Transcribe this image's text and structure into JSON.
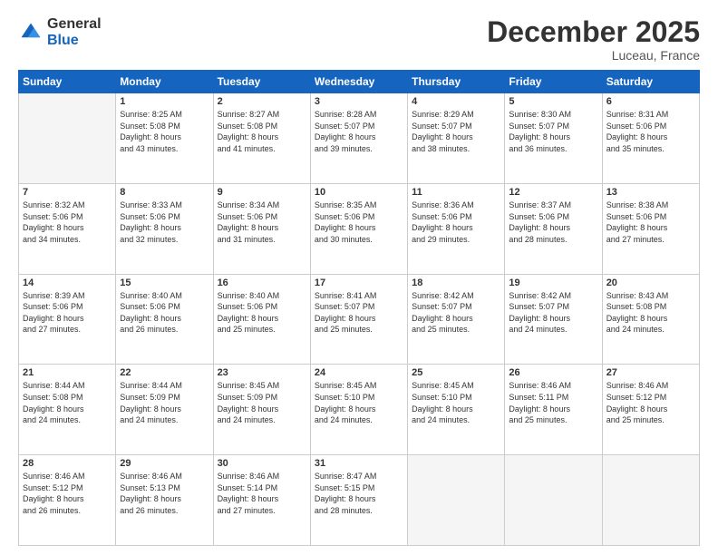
{
  "logo": {
    "general": "General",
    "blue": "Blue"
  },
  "header": {
    "month": "December 2025",
    "location": "Luceau, France"
  },
  "weekdays": [
    "Sunday",
    "Monday",
    "Tuesday",
    "Wednesday",
    "Thursday",
    "Friday",
    "Saturday"
  ],
  "weeks": [
    [
      {
        "day": "",
        "empty": true
      },
      {
        "day": "1",
        "sunrise": "Sunrise: 8:25 AM",
        "sunset": "Sunset: 5:08 PM",
        "daylight": "Daylight: 8 hours and 43 minutes."
      },
      {
        "day": "2",
        "sunrise": "Sunrise: 8:27 AM",
        "sunset": "Sunset: 5:08 PM",
        "daylight": "Daylight: 8 hours and 41 minutes."
      },
      {
        "day": "3",
        "sunrise": "Sunrise: 8:28 AM",
        "sunset": "Sunset: 5:07 PM",
        "daylight": "Daylight: 8 hours and 39 minutes."
      },
      {
        "day": "4",
        "sunrise": "Sunrise: 8:29 AM",
        "sunset": "Sunset: 5:07 PM",
        "daylight": "Daylight: 8 hours and 38 minutes."
      },
      {
        "day": "5",
        "sunrise": "Sunrise: 8:30 AM",
        "sunset": "Sunset: 5:07 PM",
        "daylight": "Daylight: 8 hours and 36 minutes."
      },
      {
        "day": "6",
        "sunrise": "Sunrise: 8:31 AM",
        "sunset": "Sunset: 5:06 PM",
        "daylight": "Daylight: 8 hours and 35 minutes."
      }
    ],
    [
      {
        "day": "7",
        "sunrise": "Sunrise: 8:32 AM",
        "sunset": "Sunset: 5:06 PM",
        "daylight": "Daylight: 8 hours and 34 minutes."
      },
      {
        "day": "8",
        "sunrise": "Sunrise: 8:33 AM",
        "sunset": "Sunset: 5:06 PM",
        "daylight": "Daylight: 8 hours and 32 minutes."
      },
      {
        "day": "9",
        "sunrise": "Sunrise: 8:34 AM",
        "sunset": "Sunset: 5:06 PM",
        "daylight": "Daylight: 8 hours and 31 minutes."
      },
      {
        "day": "10",
        "sunrise": "Sunrise: 8:35 AM",
        "sunset": "Sunset: 5:06 PM",
        "daylight": "Daylight: 8 hours and 30 minutes."
      },
      {
        "day": "11",
        "sunrise": "Sunrise: 8:36 AM",
        "sunset": "Sunset: 5:06 PM",
        "daylight": "Daylight: 8 hours and 29 minutes."
      },
      {
        "day": "12",
        "sunrise": "Sunrise: 8:37 AM",
        "sunset": "Sunset: 5:06 PM",
        "daylight": "Daylight: 8 hours and 28 minutes."
      },
      {
        "day": "13",
        "sunrise": "Sunrise: 8:38 AM",
        "sunset": "Sunset: 5:06 PM",
        "daylight": "Daylight: 8 hours and 27 minutes."
      }
    ],
    [
      {
        "day": "14",
        "sunrise": "Sunrise: 8:39 AM",
        "sunset": "Sunset: 5:06 PM",
        "daylight": "Daylight: 8 hours and 27 minutes."
      },
      {
        "day": "15",
        "sunrise": "Sunrise: 8:40 AM",
        "sunset": "Sunset: 5:06 PM",
        "daylight": "Daylight: 8 hours and 26 minutes."
      },
      {
        "day": "16",
        "sunrise": "Sunrise: 8:40 AM",
        "sunset": "Sunset: 5:06 PM",
        "daylight": "Daylight: 8 hours and 25 minutes."
      },
      {
        "day": "17",
        "sunrise": "Sunrise: 8:41 AM",
        "sunset": "Sunset: 5:07 PM",
        "daylight": "Daylight: 8 hours and 25 minutes."
      },
      {
        "day": "18",
        "sunrise": "Sunrise: 8:42 AM",
        "sunset": "Sunset: 5:07 PM",
        "daylight": "Daylight: 8 hours and 25 minutes."
      },
      {
        "day": "19",
        "sunrise": "Sunrise: 8:42 AM",
        "sunset": "Sunset: 5:07 PM",
        "daylight": "Daylight: 8 hours and 24 minutes."
      },
      {
        "day": "20",
        "sunrise": "Sunrise: 8:43 AM",
        "sunset": "Sunset: 5:08 PM",
        "daylight": "Daylight: 8 hours and 24 minutes."
      }
    ],
    [
      {
        "day": "21",
        "sunrise": "Sunrise: 8:44 AM",
        "sunset": "Sunset: 5:08 PM",
        "daylight": "Daylight: 8 hours and 24 minutes."
      },
      {
        "day": "22",
        "sunrise": "Sunrise: 8:44 AM",
        "sunset": "Sunset: 5:09 PM",
        "daylight": "Daylight: 8 hours and 24 minutes."
      },
      {
        "day": "23",
        "sunrise": "Sunrise: 8:45 AM",
        "sunset": "Sunset: 5:09 PM",
        "daylight": "Daylight: 8 hours and 24 minutes."
      },
      {
        "day": "24",
        "sunrise": "Sunrise: 8:45 AM",
        "sunset": "Sunset: 5:10 PM",
        "daylight": "Daylight: 8 hours and 24 minutes."
      },
      {
        "day": "25",
        "sunrise": "Sunrise: 8:45 AM",
        "sunset": "Sunset: 5:10 PM",
        "daylight": "Daylight: 8 hours and 24 minutes."
      },
      {
        "day": "26",
        "sunrise": "Sunrise: 8:46 AM",
        "sunset": "Sunset: 5:11 PM",
        "daylight": "Daylight: 8 hours and 25 minutes."
      },
      {
        "day": "27",
        "sunrise": "Sunrise: 8:46 AM",
        "sunset": "Sunset: 5:12 PM",
        "daylight": "Daylight: 8 hours and 25 minutes."
      }
    ],
    [
      {
        "day": "28",
        "sunrise": "Sunrise: 8:46 AM",
        "sunset": "Sunset: 5:12 PM",
        "daylight": "Daylight: 8 hours and 26 minutes."
      },
      {
        "day": "29",
        "sunrise": "Sunrise: 8:46 AM",
        "sunset": "Sunset: 5:13 PM",
        "daylight": "Daylight: 8 hours and 26 minutes."
      },
      {
        "day": "30",
        "sunrise": "Sunrise: 8:46 AM",
        "sunset": "Sunset: 5:14 PM",
        "daylight": "Daylight: 8 hours and 27 minutes."
      },
      {
        "day": "31",
        "sunrise": "Sunrise: 8:47 AM",
        "sunset": "Sunset: 5:15 PM",
        "daylight": "Daylight: 8 hours and 28 minutes."
      },
      {
        "day": "",
        "empty": true
      },
      {
        "day": "",
        "empty": true
      },
      {
        "day": "",
        "empty": true
      }
    ]
  ]
}
